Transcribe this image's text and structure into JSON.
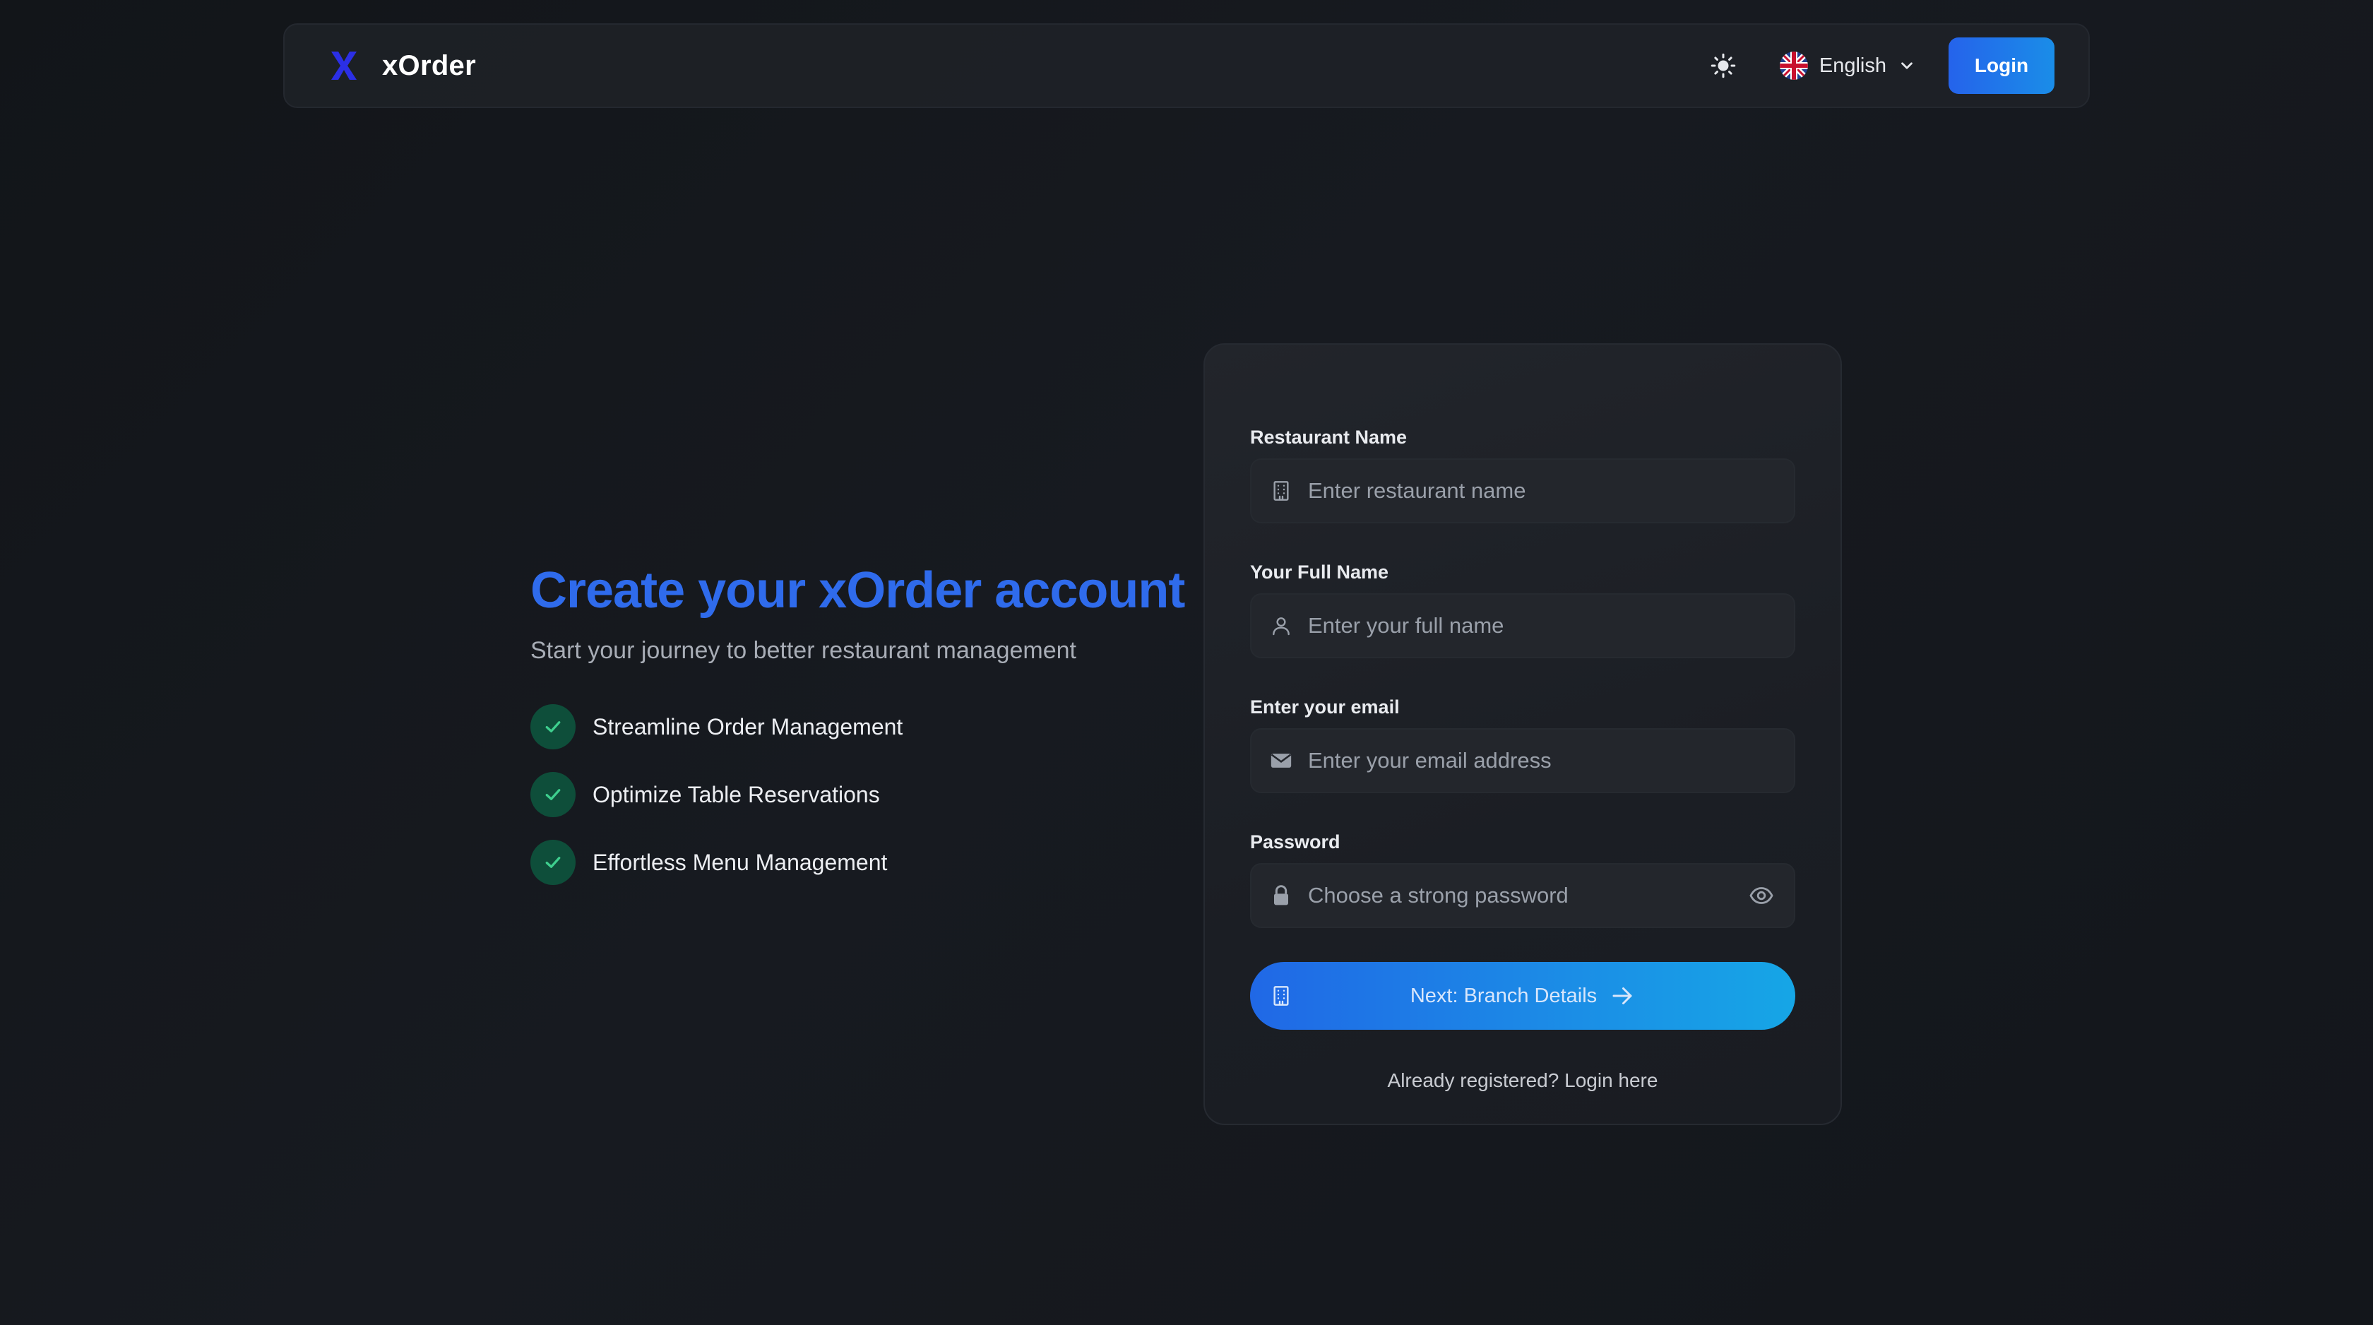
{
  "app": {
    "name": "xOrder"
  },
  "navbar": {
    "language": "English",
    "login_label": "Login"
  },
  "hero": {
    "title": "Create your xOrder account",
    "subtitle": "Start your journey to better restaurant management",
    "features": [
      "Streamline Order Management",
      "Optimize Table Reservations",
      "Effortless Menu Management"
    ]
  },
  "form": {
    "restaurant_name": {
      "label": "Restaurant Name",
      "placeholder": "Enter restaurant name",
      "value": ""
    },
    "full_name": {
      "label": "Your Full Name",
      "placeholder": "Enter your full name",
      "value": ""
    },
    "email": {
      "label": "Enter your email",
      "placeholder": "Enter your email address",
      "value": ""
    },
    "password": {
      "label": "Password",
      "placeholder": "Choose a strong password",
      "value": ""
    },
    "submit_label": "Next: Branch Details",
    "already_text": "Already registered?",
    "login_link": "Login here"
  },
  "colors": {
    "accent": "#2f6bec",
    "button_gradient_start": "#2068e6",
    "button_gradient_end": "#16a6e6",
    "check_bg": "#0e4e3a",
    "check_color": "#3ecf8e"
  }
}
